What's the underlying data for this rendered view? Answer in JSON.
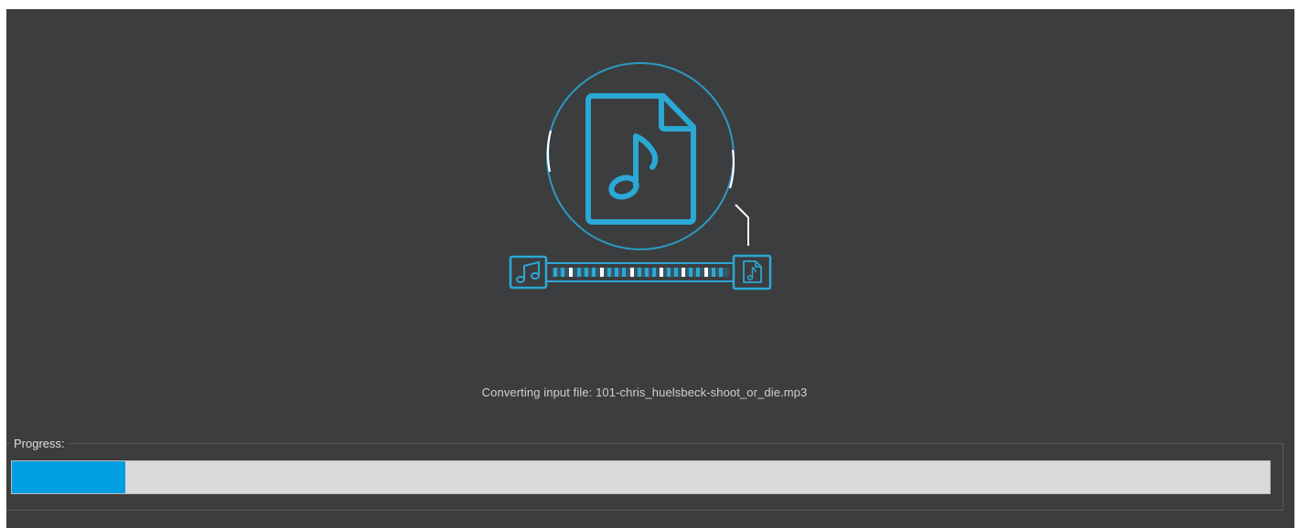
{
  "status": {
    "message": "Converting input file: 101-chris_huelsbeck-shoot_or_die.mp3"
  },
  "progress": {
    "label": "Progress:",
    "fraction": 0.09
  },
  "icons": {
    "center": "music-file-icon",
    "source": "music-notes-icon",
    "target": "music-file-icon"
  },
  "colors": {
    "background": "#3c3d3f",
    "accent": "#2aa9d6",
    "progress_fill": "#009ee3",
    "progress_track": "#dadada",
    "text": "#cfcfcf"
  }
}
